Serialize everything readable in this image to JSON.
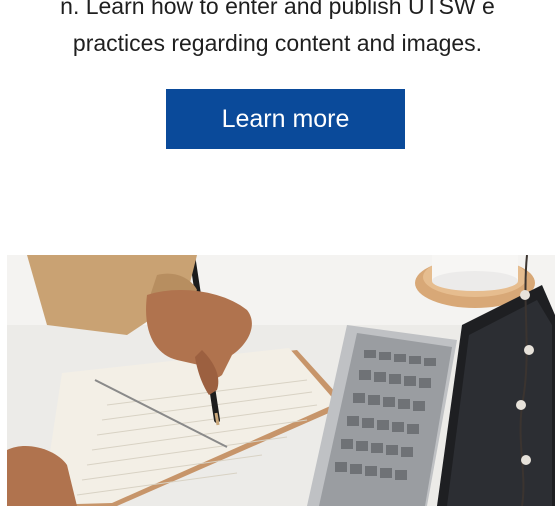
{
  "intro": {
    "line1": "n. Learn how to enter and publish UTSW e",
    "line2": "practices regarding content and images."
  },
  "cta": {
    "label": "Learn more"
  },
  "photo": {
    "subject": "person-writing-in-notebook-beside-laptop"
  }
}
